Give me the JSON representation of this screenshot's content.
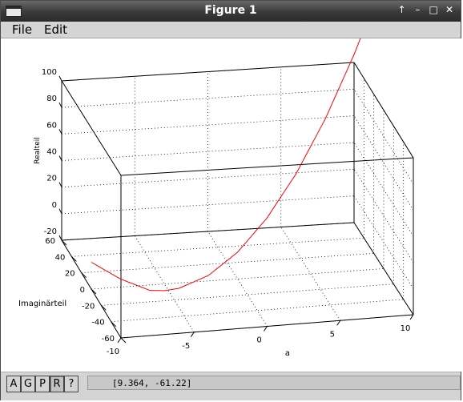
{
  "window": {
    "title": "Figure 1",
    "buttons": [
      "↑",
      "–",
      "□",
      "✕"
    ]
  },
  "menu": {
    "file": "File",
    "edit": "Edit"
  },
  "toolbar": {
    "buttons": [
      "A",
      "G",
      "P",
      "R",
      "?"
    ],
    "pressed": "R",
    "coords": "[9.364, -61.22]"
  },
  "chart_data": {
    "type": "line",
    "projection": "3d",
    "series": [
      {
        "x": [
          -10,
          -8,
          -6,
          -5,
          -4,
          -2,
          0,
          2,
          4,
          6,
          8,
          10
        ],
        "y": [
          0,
          0,
          0,
          0,
          0,
          0,
          0,
          0,
          0,
          0,
          0,
          0
        ],
        "z": [
          0,
          -14,
          -24,
          -25,
          -24,
          -16,
          0,
          24,
          56,
          96,
          144,
          200
        ],
        "color": "#ff0000"
      }
    ],
    "xlabel": "a",
    "ylabel": "Imaginärteil",
    "zlabel": "Realteil",
    "x_ticks": [
      "-10",
      "-5",
      "0",
      "5",
      "10"
    ],
    "y_ticks": [
      "-60",
      "-40",
      "-20",
      "0",
      "20",
      "40",
      "60"
    ],
    "z_ticks": [
      "-20",
      "0",
      "20",
      "40",
      "60",
      "80",
      "100"
    ],
    "xlim": [
      -10,
      10
    ],
    "ylim": [
      -60,
      60
    ],
    "zlim": [
      -20,
      100
    ],
    "grid": true
  }
}
